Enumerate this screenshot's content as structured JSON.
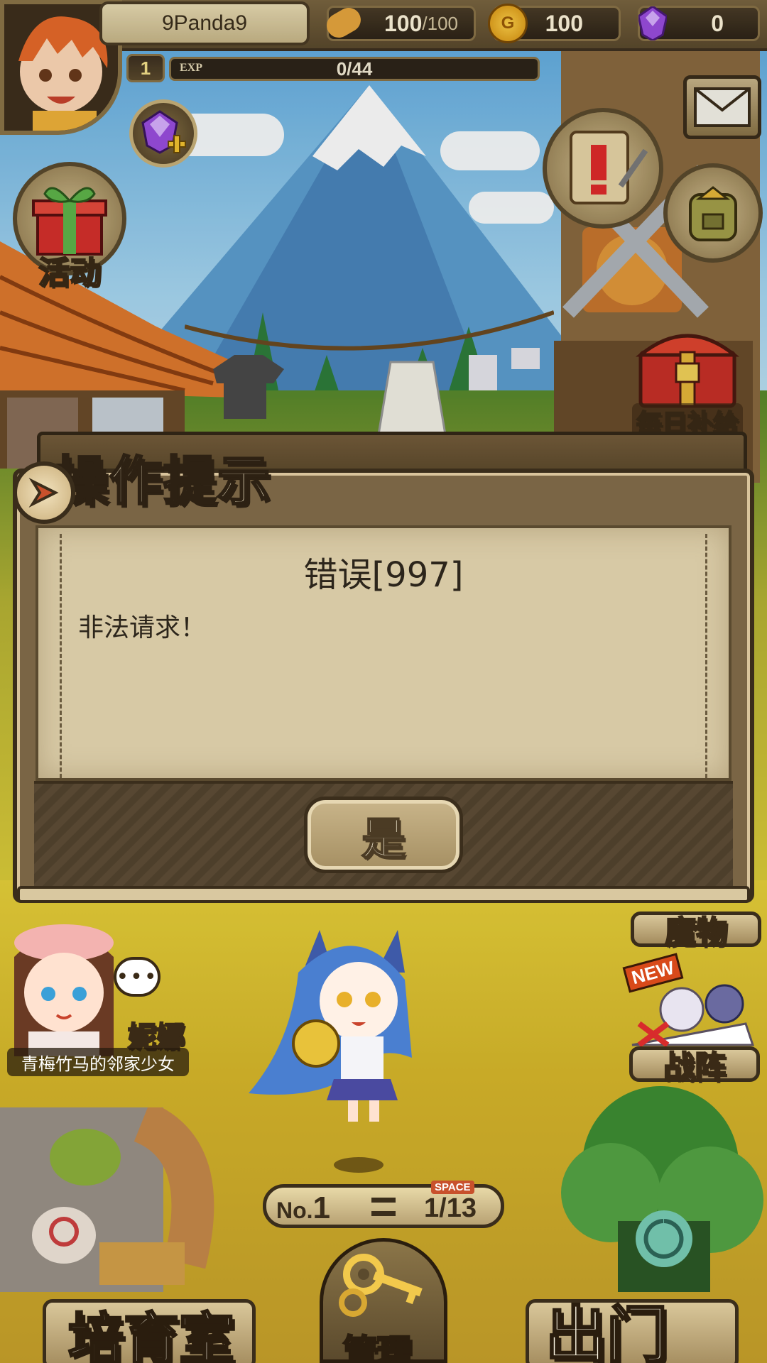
{
  "player": {
    "name": "9Panda9",
    "level": "1",
    "exp_label": "EXP",
    "exp_text": "0/44"
  },
  "resources": {
    "stamina": {
      "value": "100",
      "max": "/100",
      "icon": "bread-icon"
    },
    "gold": {
      "value": "100",
      "icon": "gold-coin-icon",
      "symbol": "G"
    },
    "gems": {
      "value": "0",
      "icon": "purple-gem-icon"
    }
  },
  "side_buttons": {
    "events_label": "活动",
    "daily_supply_label": "每日补给",
    "monsters_label": "魔物",
    "formation_label": "战阵",
    "formation_badge": "NEW"
  },
  "dialog": {
    "title": "操作提示",
    "message_title": "错误[997]",
    "message_body": "非法请求！",
    "confirm_label": "是"
  },
  "npc": {
    "name": "妮娜",
    "subtitle": "青梅竹马的邻家少女",
    "speech": "•••"
  },
  "slot": {
    "no_label": "No.",
    "no_value": "1",
    "space_label": "SPACE",
    "count": "1/13"
  },
  "bottom_nav": {
    "nursery": "培育室",
    "manage": "管理",
    "go_out": "出门"
  },
  "colors": {
    "wood_dark": "#3a2d1b",
    "parchment": "#d7c9a5",
    "accent_red": "#c8512c"
  }
}
